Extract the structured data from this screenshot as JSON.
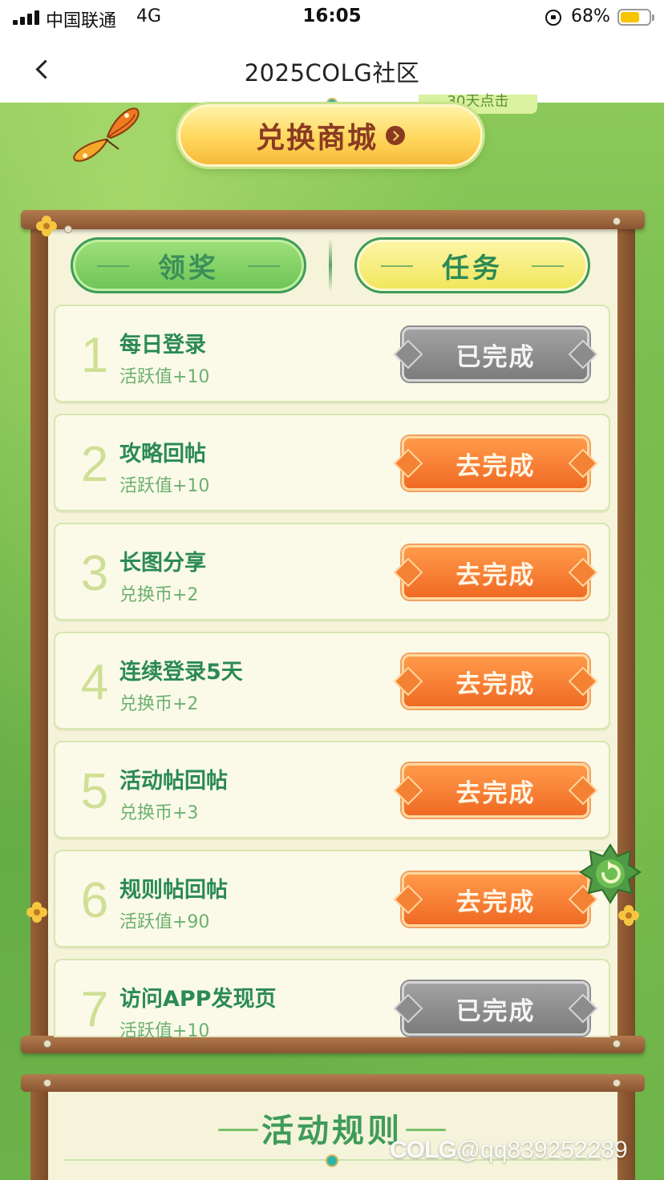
{
  "status_bar": {
    "carrier": "中国联通",
    "network": "4G",
    "time": "16:05",
    "battery_percent": "68%",
    "battery_level": 0.68
  },
  "nav": {
    "title": "2025COLG社区",
    "back_icon": "chevron-left-icon"
  },
  "shop_banner": {
    "label": "兑换商城",
    "tag_text": "30天点击",
    "arrow_icon": "chevron-right-icon"
  },
  "tabs": [
    {
      "label": "领奖",
      "active": false
    },
    {
      "label": "任务",
      "active": true
    }
  ],
  "tasks": [
    {
      "num": "1",
      "title": "每日登录",
      "reward": "活跃值+10",
      "button": "已完成",
      "status": "done"
    },
    {
      "num": "2",
      "title": "攻略回帖",
      "reward": "活跃值+10",
      "button": "去完成",
      "status": "todo"
    },
    {
      "num": "3",
      "title": "长图分享",
      "reward": "兑换币+2",
      "button": "去完成",
      "status": "todo"
    },
    {
      "num": "4",
      "title": "连续登录5天",
      "reward": "兑换币+2",
      "button": "去完成",
      "status": "todo"
    },
    {
      "num": "5",
      "title": "活动帖回帖",
      "reward": "兑换币+3",
      "button": "去完成",
      "status": "todo"
    },
    {
      "num": "6",
      "title": "规则帖回帖",
      "reward": "活跃值+90",
      "button": "去完成",
      "status": "todo"
    },
    {
      "num": "7",
      "title": "访问APP发现页",
      "reward": "活跃值+10",
      "button": "已完成",
      "status": "done"
    }
  ],
  "rules": {
    "title": "活动规则"
  },
  "watermark": {
    "brand": "COLG",
    "handle": "@qq839252289"
  },
  "colors": {
    "accent_green": "#2b8a55",
    "button_orange": "#f06a24",
    "button_gray": "#7c7c7c",
    "wood": "#8a5532"
  }
}
